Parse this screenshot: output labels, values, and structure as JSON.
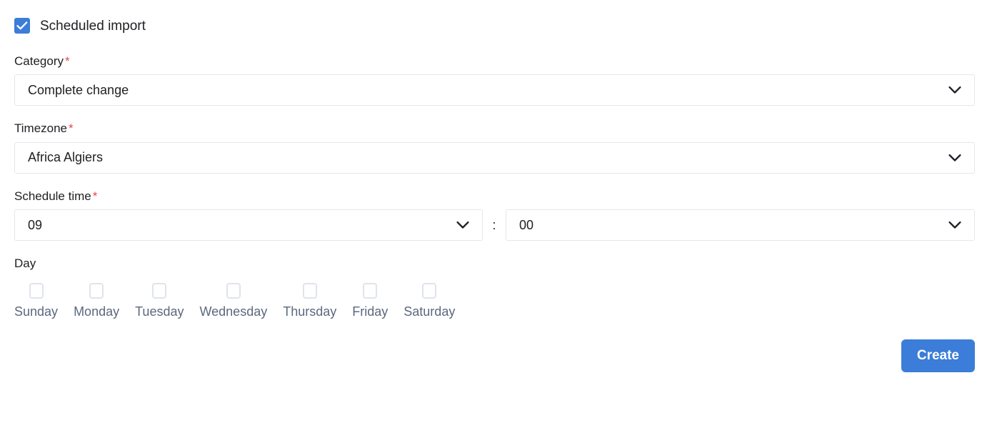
{
  "scheduled_import": {
    "label": "Scheduled import",
    "checked": true,
    "accent_color": "#3b7dd8"
  },
  "fields": {
    "category": {
      "label": "Category",
      "required_marker": "*",
      "value": "Complete change",
      "chevron": "chevron-down-icon"
    },
    "timezone": {
      "label": "Timezone",
      "required_marker": "*",
      "value": "Africa Algiers",
      "chevron": "chevron-down-icon"
    },
    "schedule_time": {
      "label": "Schedule time",
      "required_marker": "*",
      "hour_value": "09",
      "separator": ":",
      "minute_value": "00",
      "chevron": "chevron-down-icon"
    },
    "day": {
      "label": "Day",
      "items": [
        {
          "label": "Sunday",
          "checked": false
        },
        {
          "label": "Monday",
          "checked": false
        },
        {
          "label": "Tuesday",
          "checked": false
        },
        {
          "label": "Wednesday",
          "checked": false
        },
        {
          "label": "Thursday",
          "checked": false
        },
        {
          "label": "Friday",
          "checked": false
        },
        {
          "label": "Saturday",
          "checked": false
        }
      ]
    }
  },
  "footer": {
    "create_label": "Create",
    "create_color": "#3b7dd8"
  },
  "clipped_bottom_text": ""
}
